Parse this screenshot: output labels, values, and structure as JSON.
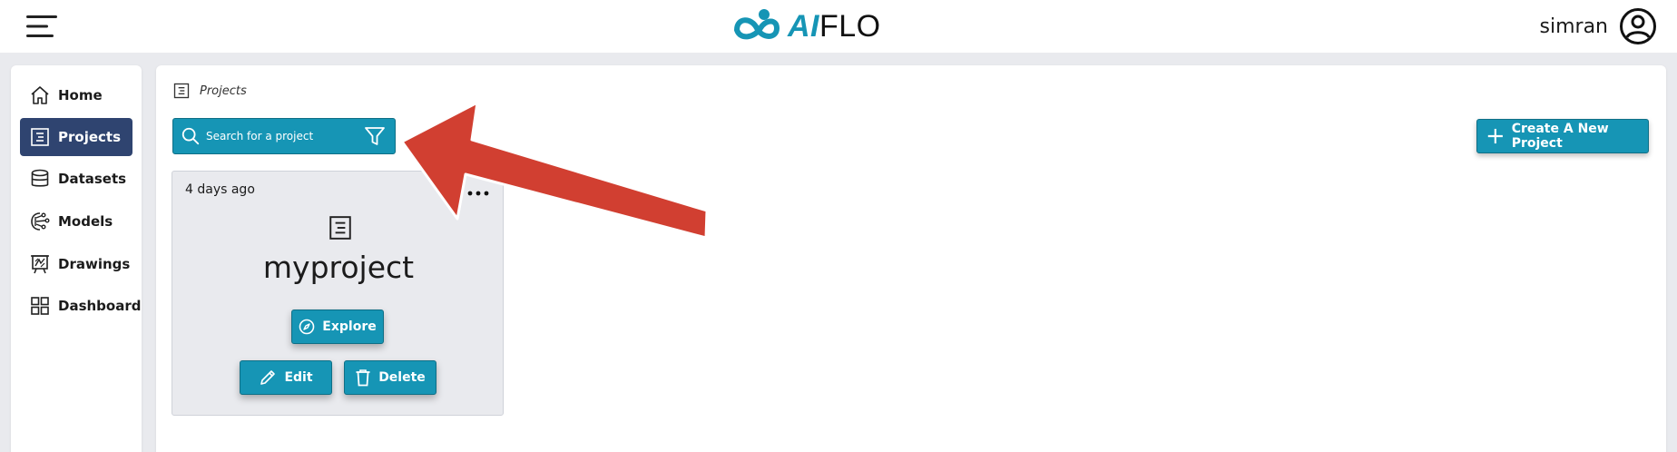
{
  "header": {
    "logo_ai": "AI",
    "logo_flo": "FLO",
    "username": "simran",
    "icons": {
      "menu": "hamburger-icon",
      "user": "user-circle-icon"
    }
  },
  "sidebar": {
    "items": [
      {
        "label": "Home",
        "icon": "home-icon",
        "active": false
      },
      {
        "label": "Projects",
        "icon": "projects-icon",
        "active": true
      },
      {
        "label": "Datasets",
        "icon": "database-icon",
        "active": false
      },
      {
        "label": "Models",
        "icon": "models-icon",
        "active": false
      },
      {
        "label": "Drawings",
        "icon": "drawings-icon",
        "active": false
      },
      {
        "label": "Dashboard",
        "icon": "dashboard-icon",
        "active": false
      }
    ]
  },
  "main": {
    "breadcrumb": "Projects",
    "search": {
      "placeholder": "Search for a project"
    },
    "create_button": "Create A New Project",
    "projects": [
      {
        "time": "4 days ago",
        "name": "myproject",
        "explore_label": "Explore",
        "edit_label": "Edit",
        "delete_label": "Delete"
      }
    ]
  },
  "colors": {
    "accent": "#1695b5",
    "active_nav": "#2f4470",
    "page_bg": "#e9eaee",
    "annotation_arrow": "#d13f31"
  }
}
